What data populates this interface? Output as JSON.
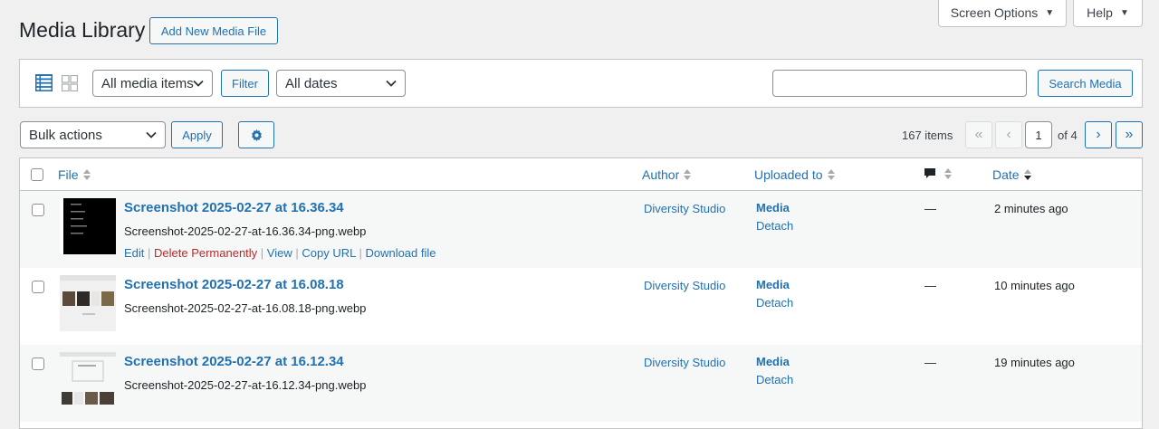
{
  "header": {
    "title": "Media Library",
    "add_new": "Add New Media File",
    "screen_options": "Screen Options",
    "help": "Help"
  },
  "filters": {
    "media_type": "All media items",
    "filter_button": "Filter",
    "dates": "All dates",
    "search_placeholder": "",
    "search_button": "Search Media"
  },
  "bulk": {
    "actions": "Bulk actions",
    "apply": "Apply"
  },
  "pagination": {
    "items": "167 items",
    "first": "«",
    "prev": "‹",
    "current_page": "1",
    "of_total": "of 4",
    "next": "›",
    "last": "»"
  },
  "table": {
    "columns": {
      "file": "File",
      "author": "Author",
      "uploaded_to": "Uploaded to",
      "date": "Date"
    },
    "rows": [
      {
        "title": "Screenshot 2025-02-27 at 16.36.34",
        "filename": "Screenshot-2025-02-27-at-16.36.34-png.webp",
        "author": "Diversity Studio",
        "uploaded_to": "Media",
        "detach": "Detach",
        "comments": "—",
        "date": "2 minutes ago",
        "actions": {
          "edit": "Edit",
          "delete": "Delete Permanently",
          "view": "View",
          "copy": "Copy URL",
          "download": "Download file"
        }
      },
      {
        "title": "Screenshot 2025-02-27 at 16.08.18",
        "filename": "Screenshot-2025-02-27-at-16.08.18-png.webp",
        "author": "Diversity Studio",
        "uploaded_to": "Media",
        "detach": "Detach",
        "comments": "—",
        "date": "10 minutes ago"
      },
      {
        "title": "Screenshot 2025-02-27 at 16.12.34",
        "filename": "Screenshot-2025-02-27-at-16.12.34-png.webp",
        "author": "Diversity Studio",
        "uploaded_to": "Media",
        "detach": "Detach",
        "comments": "—",
        "date": "19 minutes ago"
      }
    ]
  },
  "icons": {
    "list_view": "list-view-icon",
    "grid_view": "grid-view-icon",
    "settings": "gear-icon",
    "comments": "comment-icon"
  },
  "colors": {
    "accent": "#2271b1",
    "delete": "#b32d2e",
    "background": "#f0f0f1"
  }
}
